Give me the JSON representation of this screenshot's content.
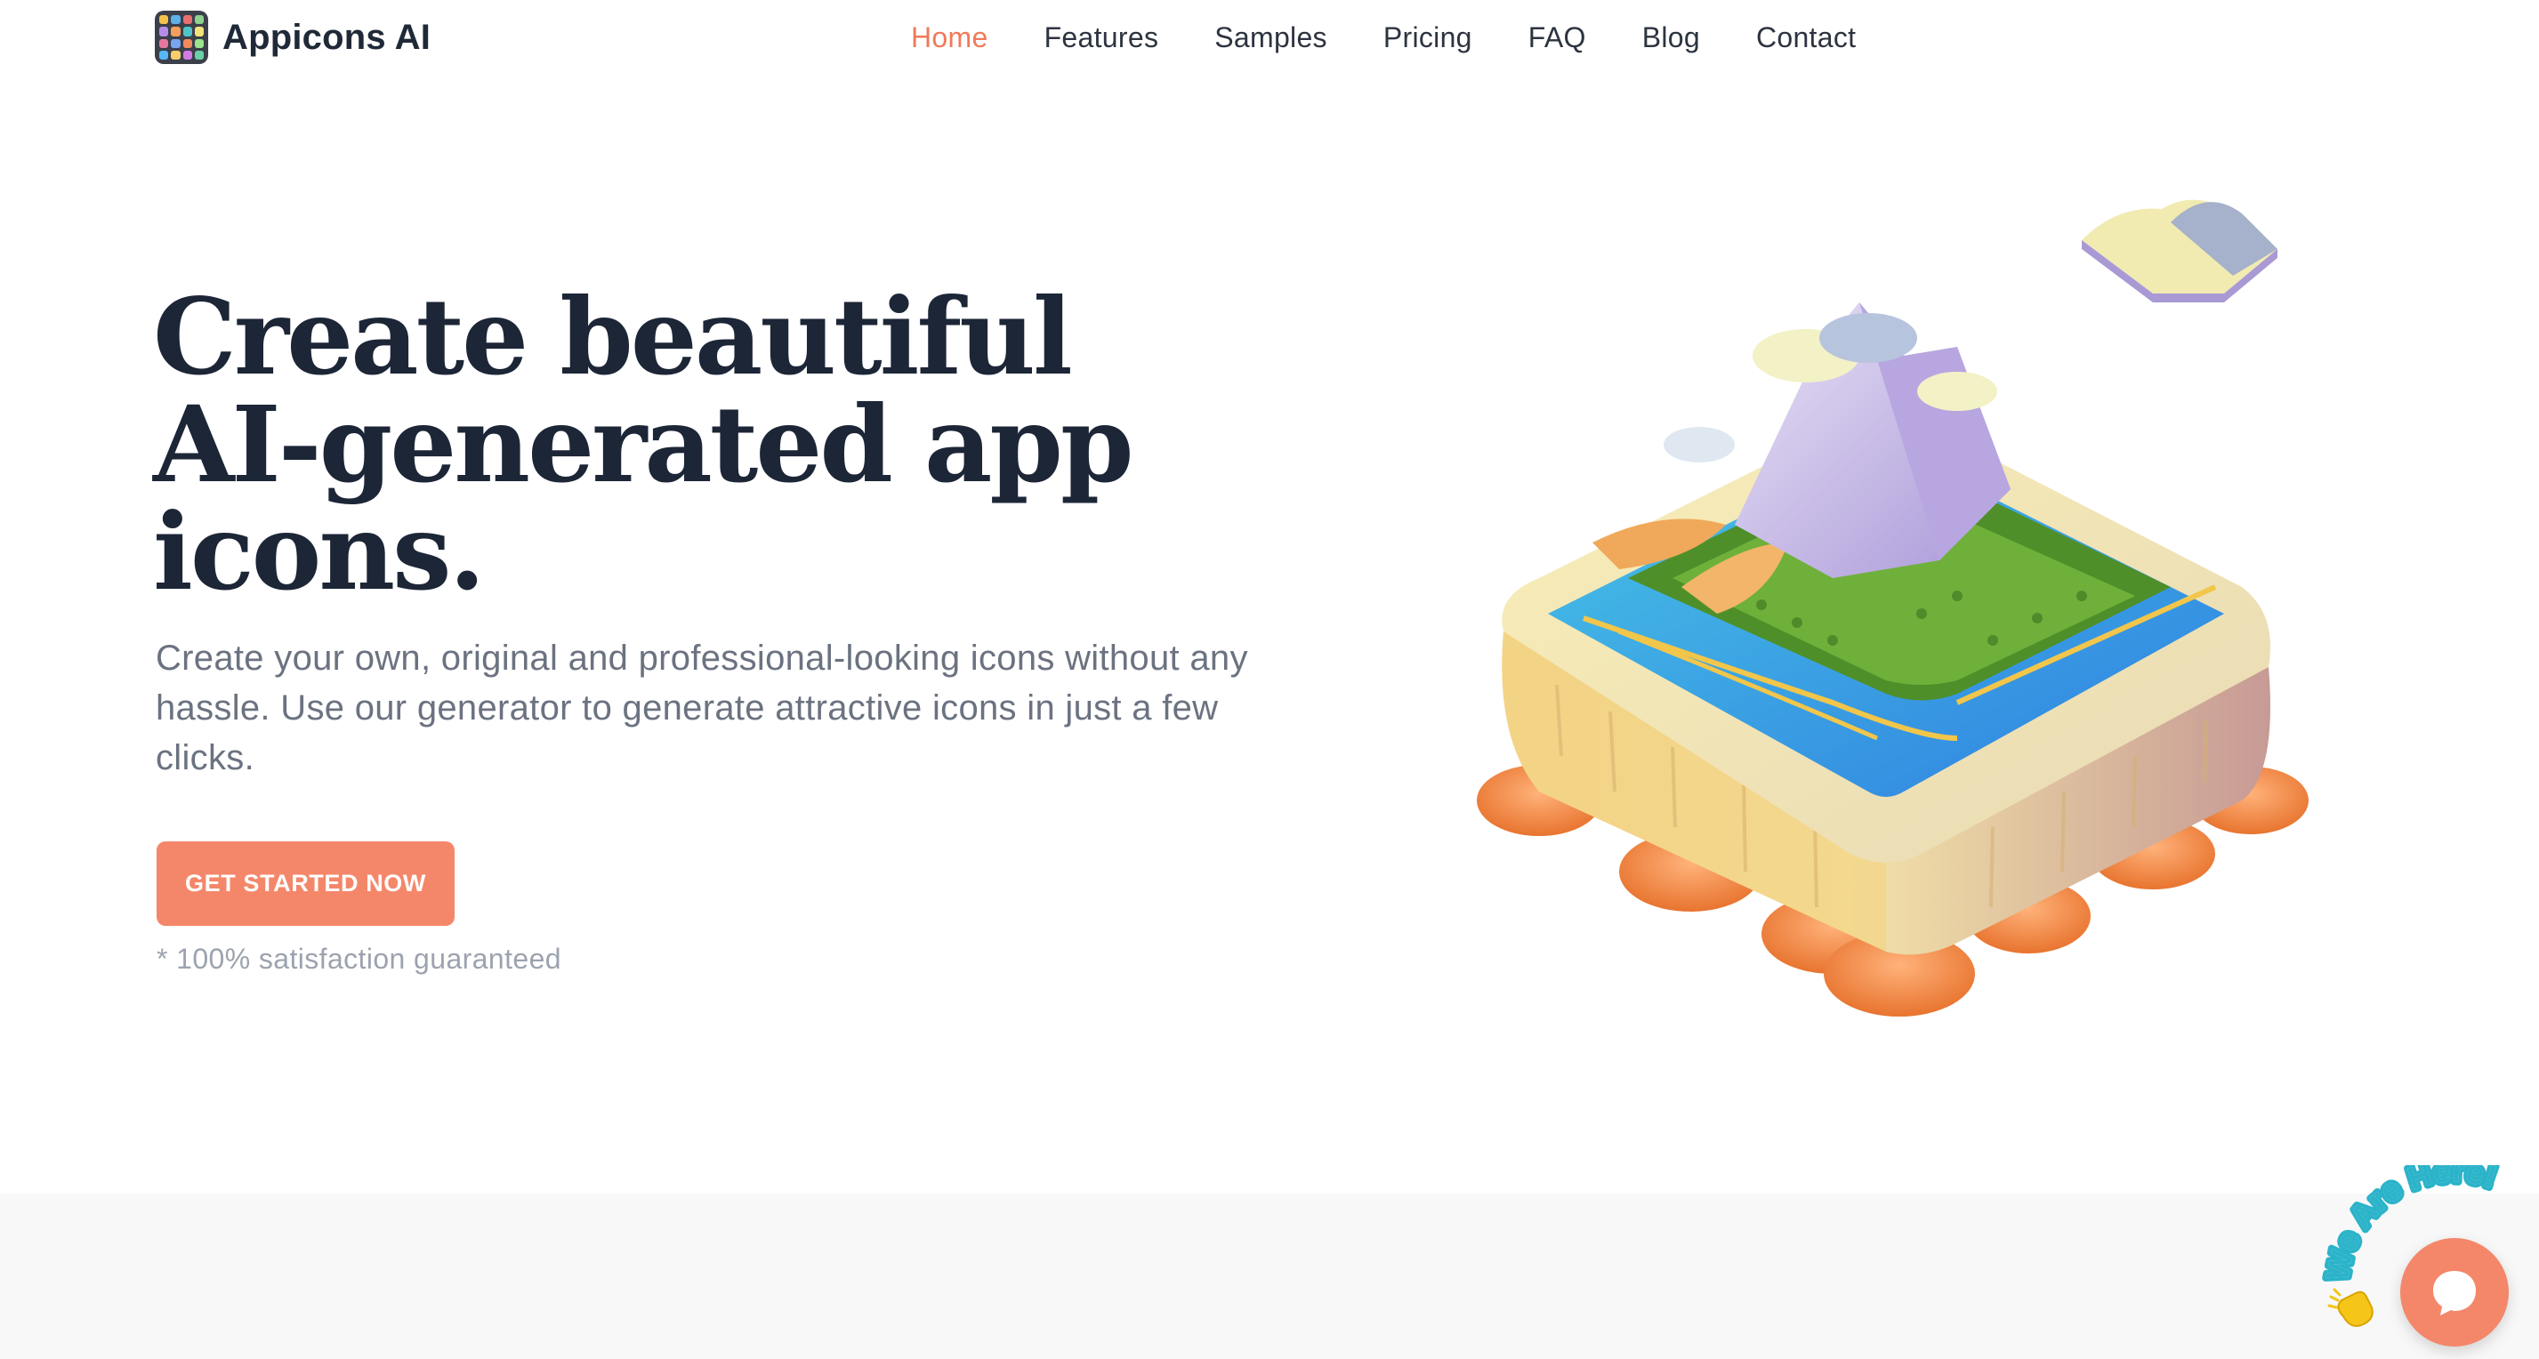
{
  "brand": {
    "name": "Appicons AI",
    "logo_icon": "app-grid-logo-icon"
  },
  "nav": {
    "items": [
      {
        "label": "Home",
        "active": true
      },
      {
        "label": "Features",
        "active": false
      },
      {
        "label": "Samples",
        "active": false
      },
      {
        "label": "Pricing",
        "active": false
      },
      {
        "label": "FAQ",
        "active": false
      },
      {
        "label": "Blog",
        "active": false
      },
      {
        "label": "Contact",
        "active": false
      }
    ]
  },
  "hero": {
    "title_line1": "Create beautiful",
    "title_line2": "AI-generated app",
    "title_line3": "icons.",
    "subtitle": "Create your own, original and professional-looking icons without any hassle. Use our generator to generate attractive icons in just a few clicks.",
    "cta_label": "GET STARTED NOW",
    "guarantee": "* 100% satisfaction guaranteed",
    "illustration_icon": "floating-island-illustration"
  },
  "chat_widget": {
    "badge_text": "We Are Here!",
    "wave_icon": "waving-hand-icon",
    "button_icon": "chat-bubble-icon"
  },
  "colors": {
    "accent": "#f4876a",
    "nav_active": "#ef7a5a",
    "heading": "#1c2637",
    "body_text": "#6b7280",
    "muted_text": "#9ca3af",
    "chat_text": "#2bb3c9",
    "lower_section_bg": "#f8f8f8"
  }
}
